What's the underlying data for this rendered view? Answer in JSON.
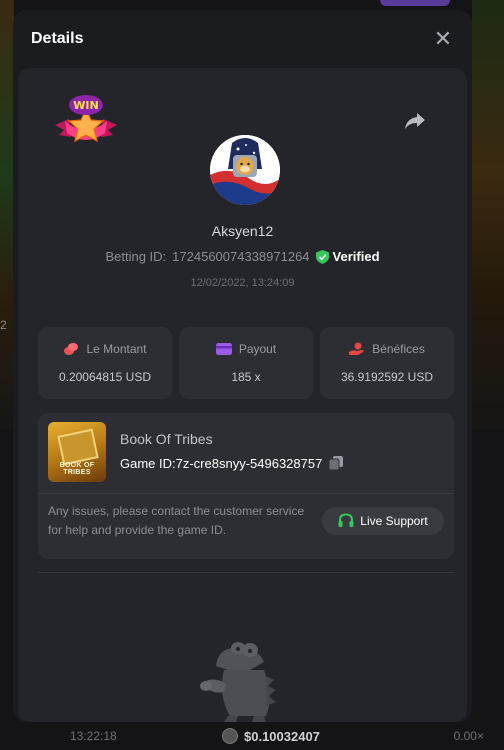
{
  "background": {
    "left_fragment": "2",
    "time": "13:22:18",
    "amount": "$0.10032407",
    "multiplier": "0.00×"
  },
  "modal": {
    "title": "Details",
    "close_icon": "close-icon"
  },
  "bet": {
    "badge_text": "WIN",
    "username": "Aksyen12",
    "betting_id_label": "Betting ID:",
    "betting_id": "1724560074338971264",
    "verified": "Verified",
    "date": "12/02/2022, 13:24:09"
  },
  "stats": [
    {
      "label": "Le Montant",
      "value": "0.20064815 USD",
      "icon": "coins-icon",
      "color": "#e8535a"
    },
    {
      "label": "Payout",
      "value": "185 x",
      "icon": "wallet-icon",
      "color": "#9b5de5"
    },
    {
      "label": "Bénéfices",
      "value": "36.9192592 USD",
      "icon": "hand-coin-icon",
      "color": "#e84545"
    }
  ],
  "game": {
    "name": "Book Of Tribes",
    "thumb_label": "BOOK OF TRIBES",
    "id_label": "Game ID:",
    "id": "7z-cre8snyy-5496328757",
    "issue_text": "Any issues, please contact the customer service for help and provide the game ID.",
    "support_label": "Live Support"
  },
  "colors": {
    "verified": "#34c759",
    "support_icon": "#34c759",
    "modal_bg": "#1b1c1f",
    "card_bg": "#24252a"
  }
}
